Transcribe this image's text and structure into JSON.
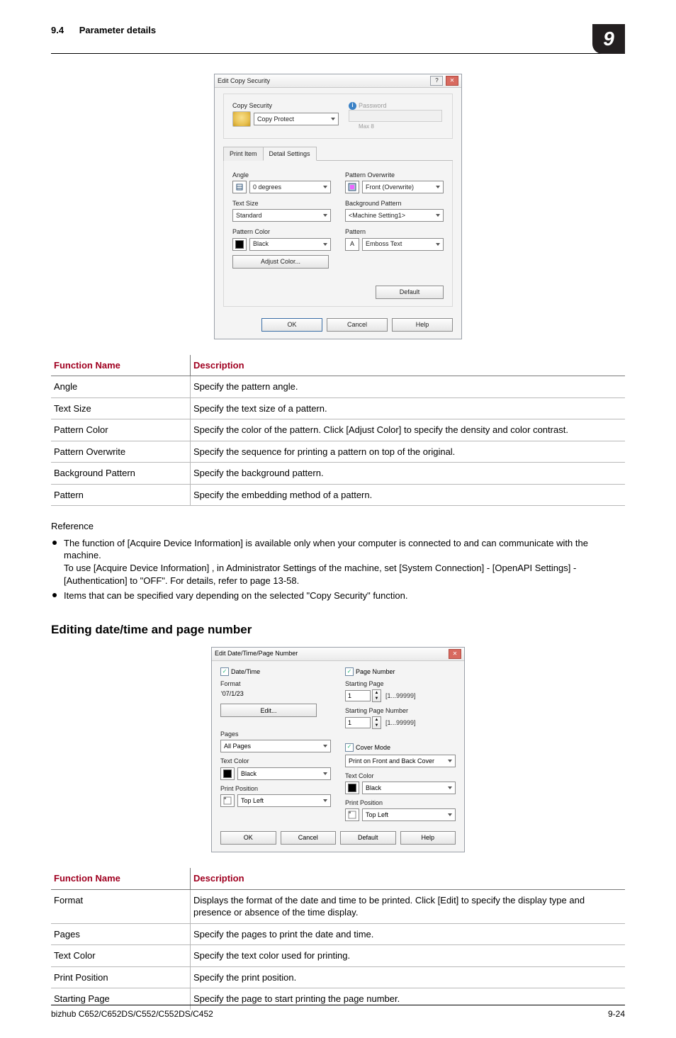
{
  "header": {
    "section_number": "9.4",
    "section_title": "Parameter details",
    "chapter_number": "9"
  },
  "dialog1": {
    "title": "Edit Copy Security",
    "copy_security_label": "Copy Security",
    "copy_protect_label": "Copy Protect",
    "password_label": "Password",
    "password_hint": "Max 8",
    "tabs": {
      "print_item": "Print Item",
      "detail_settings": "Detail Settings"
    },
    "angle": {
      "label": "Angle",
      "value": "0 degrees"
    },
    "text_size": {
      "label": "Text Size",
      "value": "Standard"
    },
    "pattern_color": {
      "label": "Pattern Color",
      "value": "Black",
      "adjust_button": "Adjust Color..."
    },
    "pattern_overwrite": {
      "label": "Pattern Overwrite",
      "value": "Front (Overwrite)"
    },
    "background_pattern": {
      "label": "Background Pattern",
      "value": "<Machine Setting1>"
    },
    "pattern": {
      "label": "Pattern",
      "value": "Emboss Text",
      "icon_text": "A"
    },
    "default_button": "Default",
    "buttons": {
      "ok": "OK",
      "cancel": "Cancel",
      "help": "Help"
    }
  },
  "table1": {
    "headers": {
      "name": "Function Name",
      "desc": "Description"
    },
    "rows": [
      {
        "name": "Angle",
        "desc": "Specify the pattern angle."
      },
      {
        "name": "Text Size",
        "desc": "Specify the text size of a pattern."
      },
      {
        "name": "Pattern Color",
        "desc": "Specify the color of the pattern. Click [Adjust Color] to specify the density and color contrast."
      },
      {
        "name": "Pattern Overwrite",
        "desc": "Specify the sequence for printing a pattern on top of the original."
      },
      {
        "name": "Background Pattern",
        "desc": "Specify the background pattern."
      },
      {
        "name": "Pattern",
        "desc": "Specify the embedding method of a pattern."
      }
    ]
  },
  "reference": {
    "label": "Reference",
    "item1_line1": "The function of [Acquire Device Information] is available only when your computer is connected to and can communicate with the machine.",
    "item1_line2": "To use [Acquire Device Information] , in Administrator Settings of the machine, set [System Connection] - [OpenAPI Settings] - [Authentication] to \"OFF\". For details, refer to page 13-58.",
    "item2": "Items that can be specified vary depending on the selected \"Copy Security\" function."
  },
  "section2_title": "Editing date/time and page number",
  "dialog2": {
    "title": "Edit Date/Time/Page Number",
    "date_time_chk": "Date/Time",
    "format_label": "Format",
    "format_value": "'07/1/23",
    "edit_button": "Edit...",
    "pages_label": "Pages",
    "pages_value": "All Pages",
    "text_color_label": "Text Color",
    "text_color_value": "Black",
    "print_position_label": "Print Position",
    "print_position_value": "Top Left",
    "page_number_chk": "Page Number",
    "starting_page_label": "Starting Page",
    "starting_page_value": "1",
    "starting_page_range": "[1...99999]",
    "starting_page_number_label": "Starting Page Number",
    "starting_page_number_value": "1",
    "starting_page_number_range": "[1...99999]",
    "cover_mode_chk": "Cover Mode",
    "cover_mode_value": "Print on Front and Back Cover",
    "buttons": {
      "ok": "OK",
      "cancel": "Cancel",
      "default": "Default",
      "help": "Help"
    }
  },
  "table2": {
    "headers": {
      "name": "Function Name",
      "desc": "Description"
    },
    "rows": [
      {
        "name": "Format",
        "desc": "Displays the format of the date and time to be printed. Click [Edit] to specify the display type and presence or absence of the time display."
      },
      {
        "name": "Pages",
        "desc": "Specify the pages to print the date and time."
      },
      {
        "name": "Text Color",
        "desc": "Specify the text color used for printing."
      },
      {
        "name": "Print Position",
        "desc": "Specify the print position."
      },
      {
        "name": "Starting Page",
        "desc": "Specify the page to start printing the page number."
      }
    ]
  },
  "footer": {
    "model": "bizhub C652/C652DS/C552/C552DS/C452",
    "page": "9-24"
  }
}
